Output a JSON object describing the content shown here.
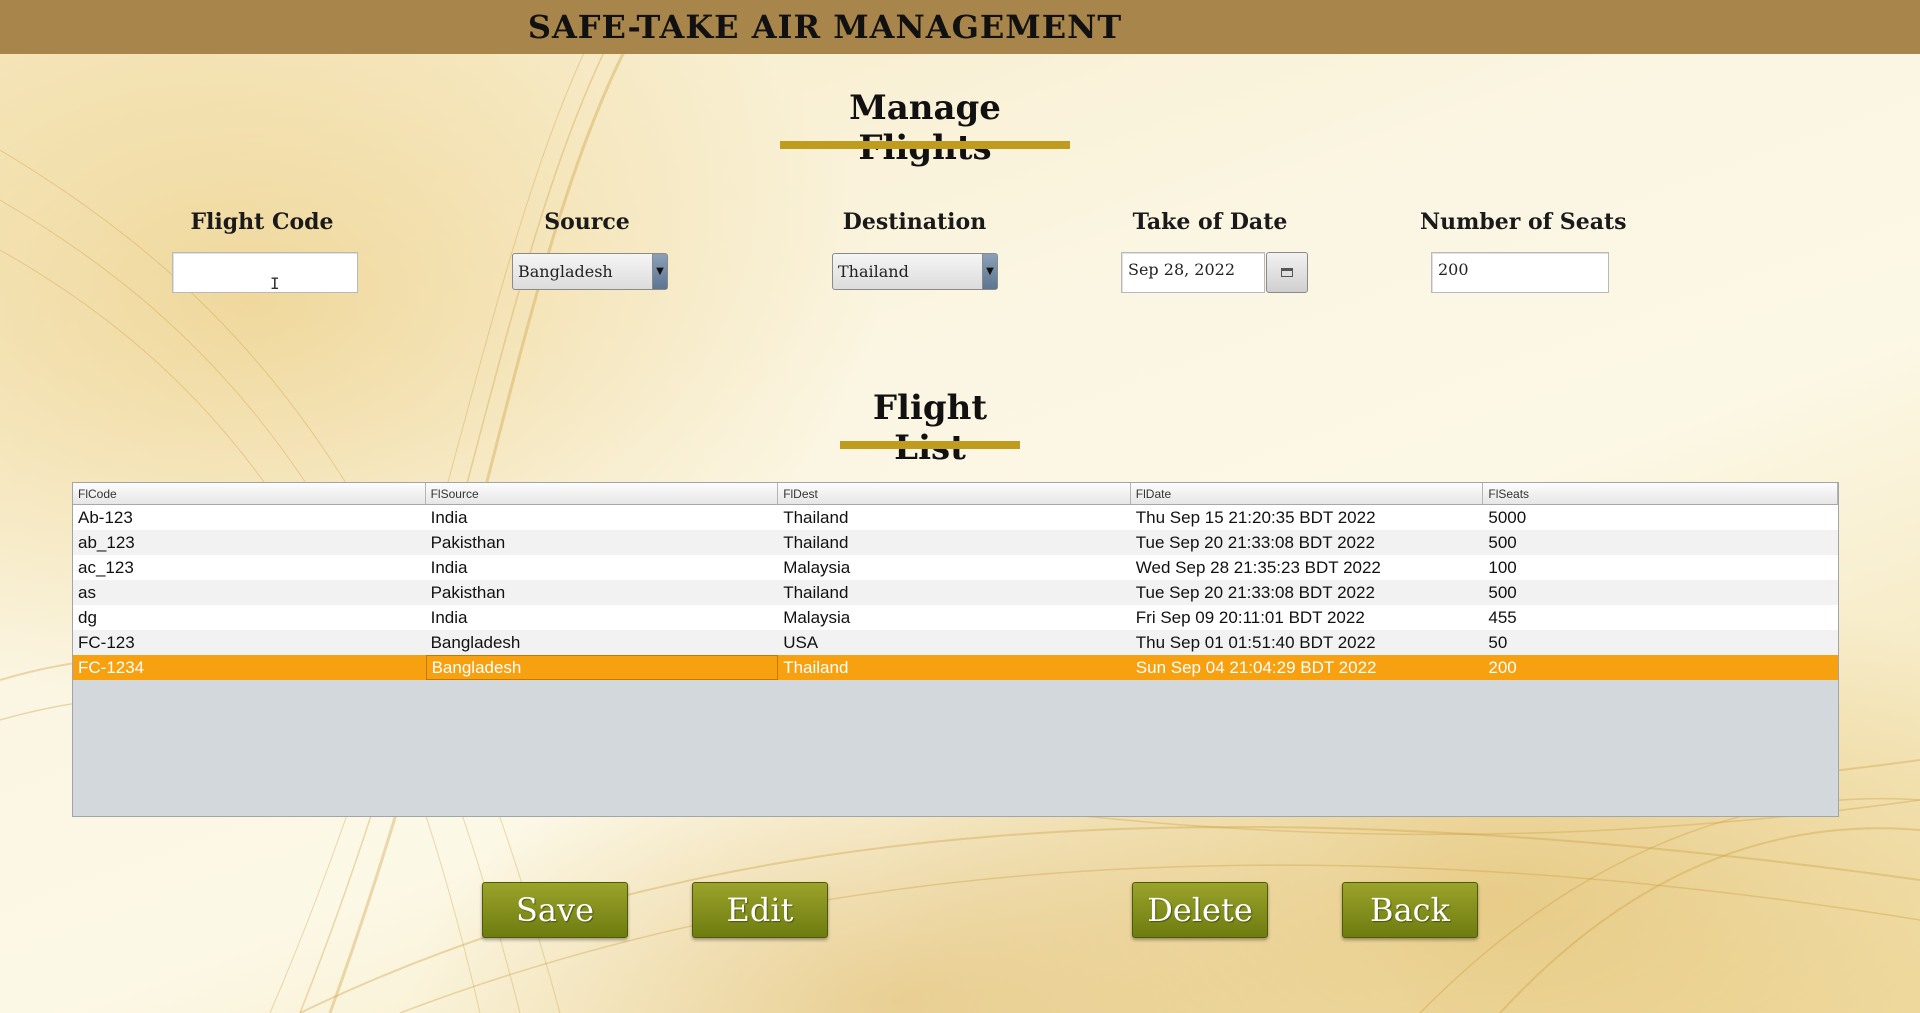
{
  "app": {
    "title": "SAFE-TAKE AIR MANAGEMENT"
  },
  "manage": {
    "title": "Manage Flights"
  },
  "form": {
    "flight_code": {
      "label": "Flight Code",
      "value": ""
    },
    "source": {
      "label": "Source",
      "value": "Bangladesh"
    },
    "destination": {
      "label": "Destination",
      "value": "Thailand"
    },
    "take_of_date": {
      "label": "Take of Date",
      "value": "Sep 28, 2022"
    },
    "seats": {
      "label": "Number of Seats",
      "value": "200"
    }
  },
  "flight_list": {
    "title": "Flight List",
    "columns": [
      "FlCode",
      "FlSource",
      "FlDest",
      "FlDate",
      "FlSeats"
    ],
    "rows": [
      [
        "Ab-123",
        "India",
        "Thailand",
        "Thu Sep 15 21:20:35 BDT 2022",
        "5000"
      ],
      [
        "ab_123",
        "Pakisthan",
        "Thailand",
        "Tue Sep 20 21:33:08 BDT 2022",
        "500"
      ],
      [
        "ac_123",
        "India",
        "Malaysia",
        "Wed Sep 28 21:35:23 BDT 2022",
        "100"
      ],
      [
        "as",
        "Pakisthan",
        "Thailand",
        "Tue Sep 20 21:33:08 BDT 2022",
        "500"
      ],
      [
        "dg",
        "India",
        "Malaysia",
        "Fri Sep 09 20:11:01 BDT 2022",
        "455"
      ],
      [
        "FC-123",
        "Bangladesh",
        "USA",
        "Thu Sep 01 01:51:40 BDT 2022",
        "50"
      ],
      [
        "FC-1234",
        "Bangladesh",
        "Thailand",
        "Sun Sep 04 21:04:29 BDT 2022",
        "200"
      ]
    ],
    "selected_row": 6
  },
  "buttons": {
    "save": "Save",
    "edit": "Edit",
    "delete": "Delete",
    "back": "Back"
  },
  "colors": {
    "header_bar": "#a8854b",
    "accent_underline": "#bf9b1e",
    "selection": "#f7a010",
    "button": "#7f8c16"
  }
}
